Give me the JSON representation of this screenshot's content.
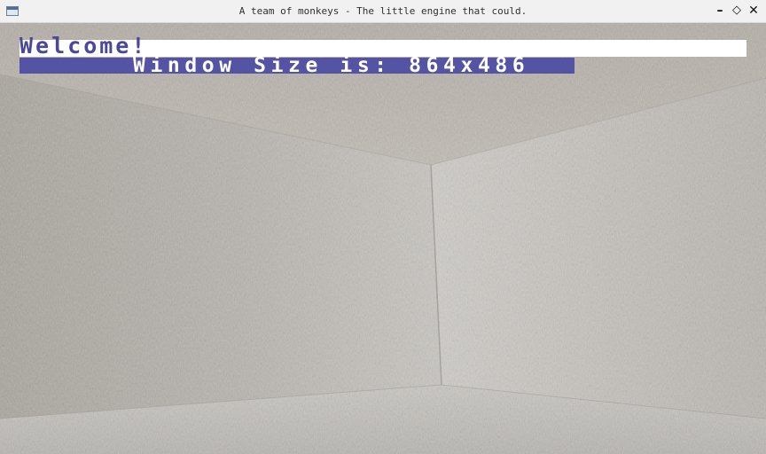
{
  "window": {
    "title": "A team of monkeys - The little engine that could.",
    "icons": {
      "app": "window-app-icon",
      "minimize": "minimize-icon",
      "maximize": "maximize-icon",
      "close": "close-icon"
    },
    "minimize_glyph": "–",
    "maximize_glyph": "◇",
    "close_glyph": "✕"
  },
  "hud": {
    "welcome": "Welcome!",
    "window_size": "Window Size is: 864x486"
  },
  "colors": {
    "hud_text_dark": "#4b4997",
    "hud_bar": "#5553a3",
    "hud_bar_light": "#ffffff",
    "wall": "#bcb8b2"
  }
}
